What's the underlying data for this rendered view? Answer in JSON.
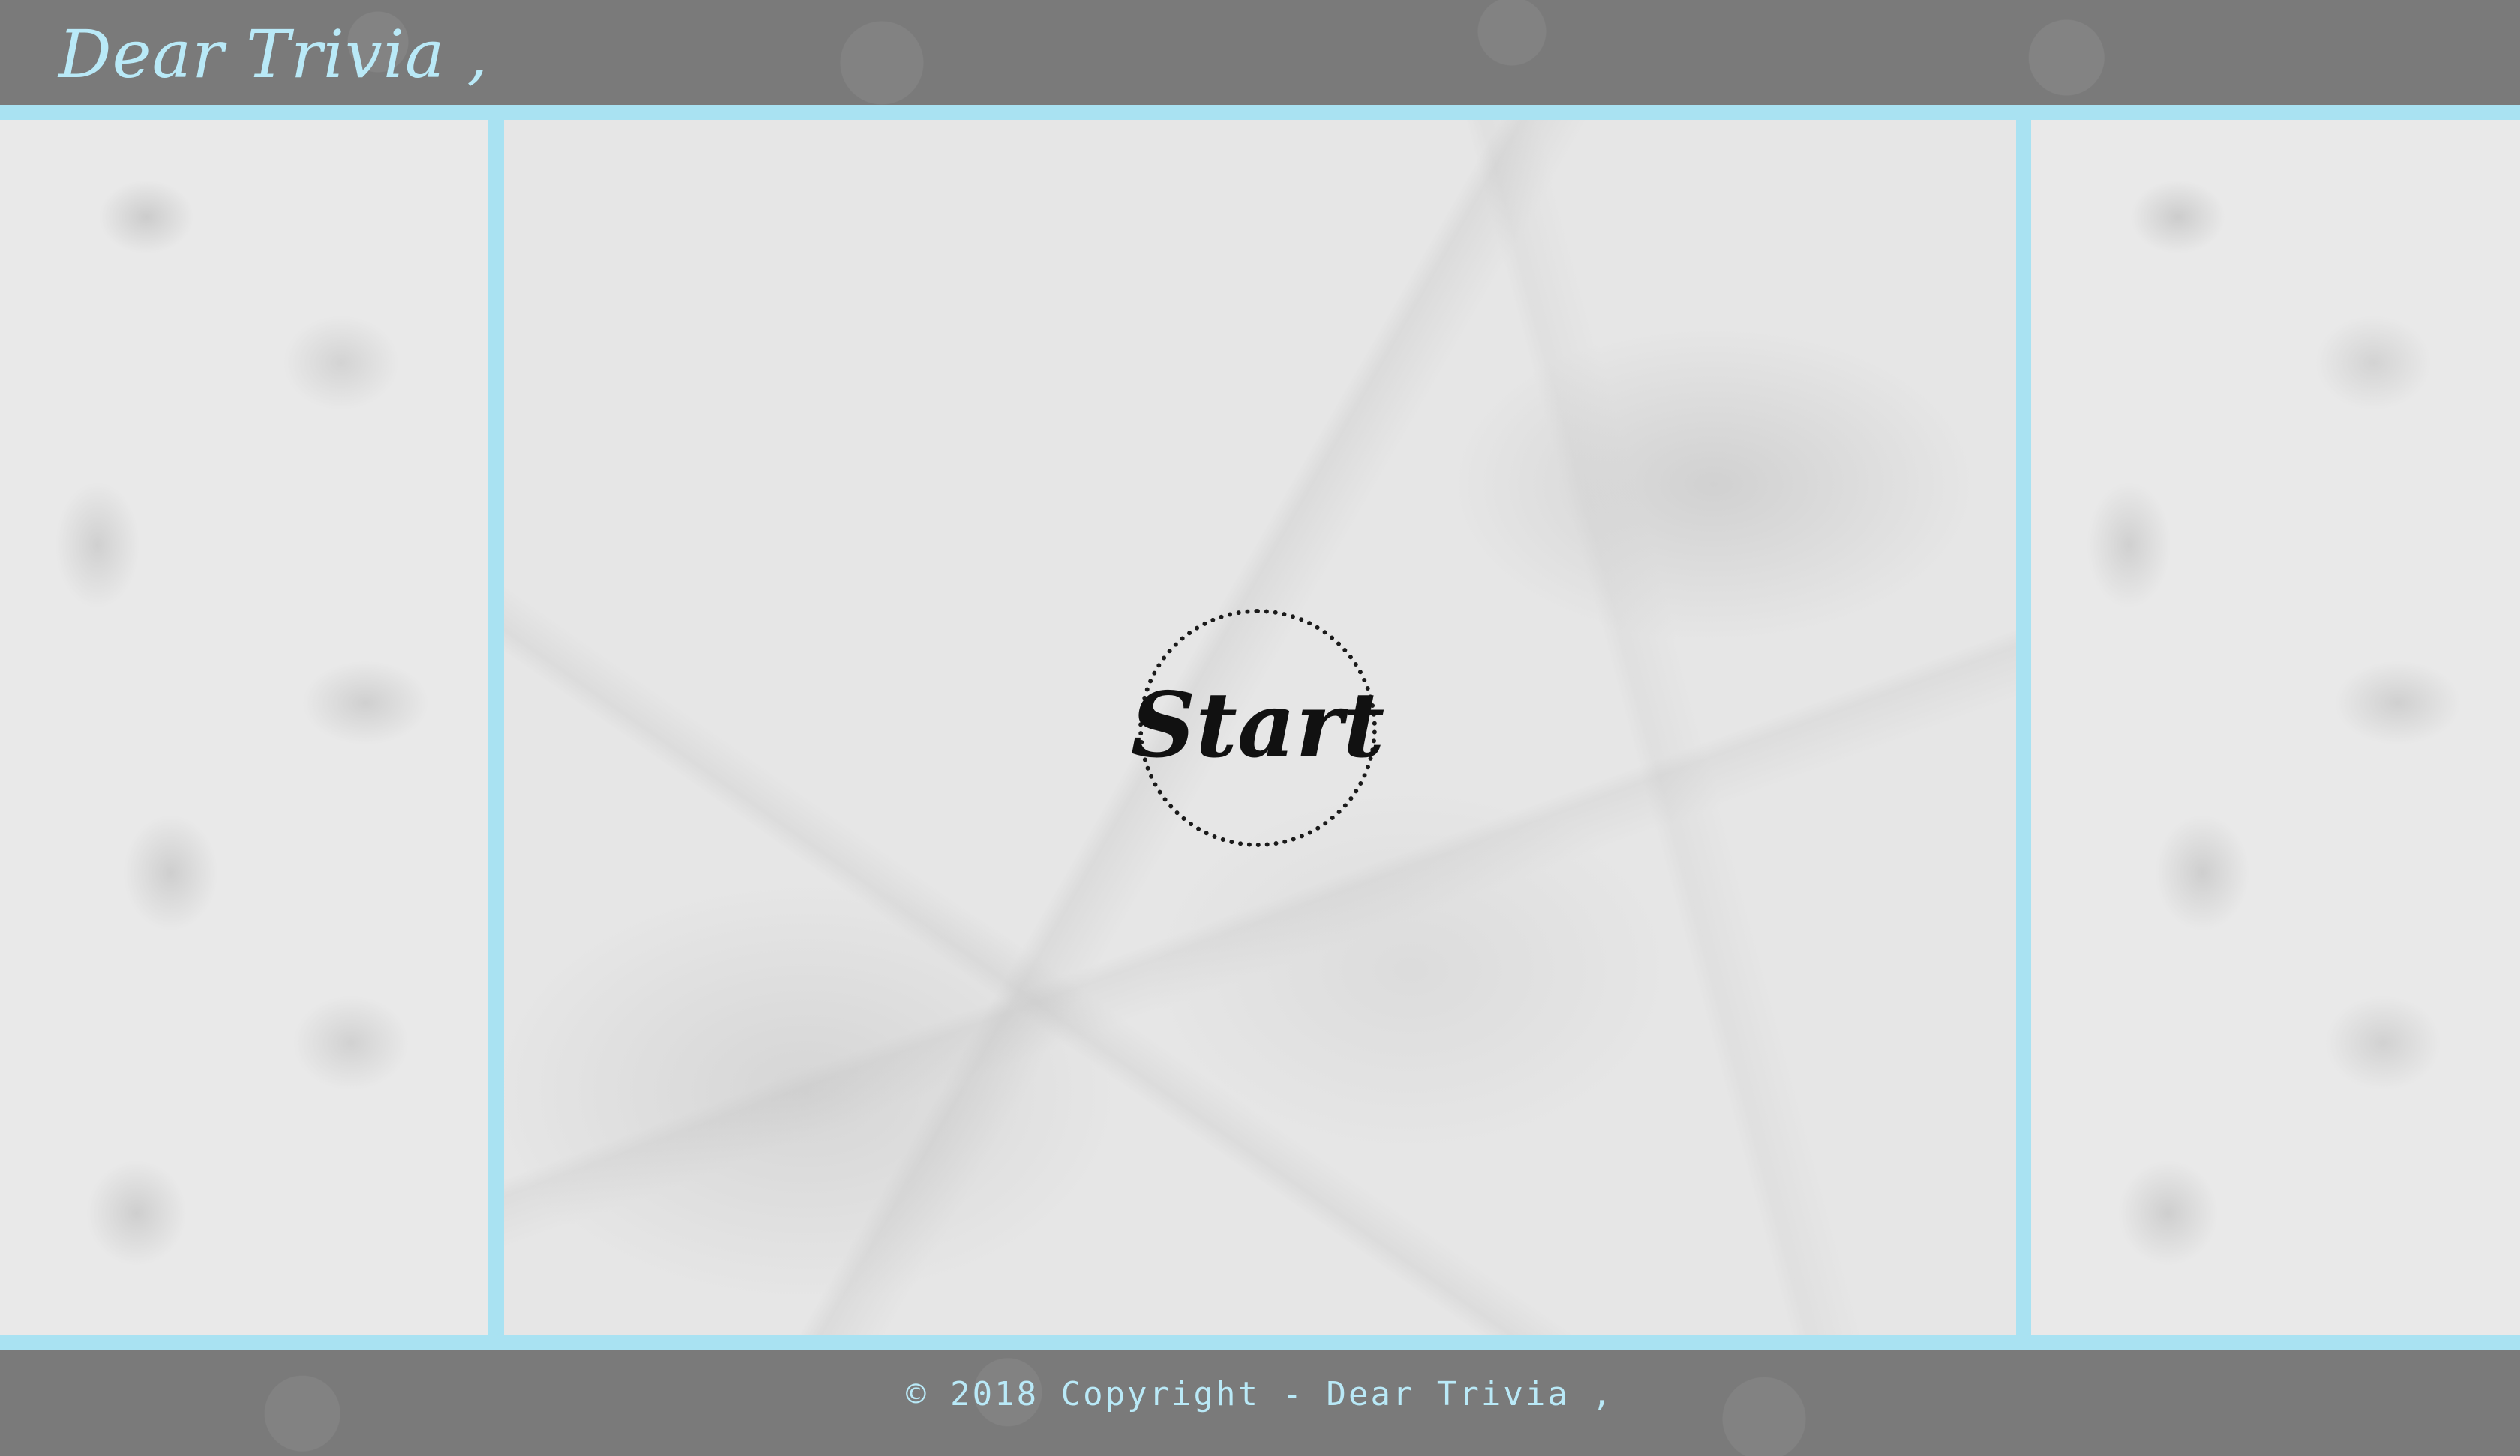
{
  "header": {
    "title": "Dear Trivia ,"
  },
  "main": {
    "start_label": "Start"
  },
  "footer": {
    "copyright": "© 2018 Copyright - Dear Trivia ,"
  },
  "colors": {
    "accent": "#a9e2f2",
    "header_bg": "#7a7a7a",
    "title_text": "#b9e9f7",
    "start_text": "#111111"
  },
  "icons": {
    "side_panels": "floral-pattern",
    "paper": "crumpled-paper-texture"
  }
}
